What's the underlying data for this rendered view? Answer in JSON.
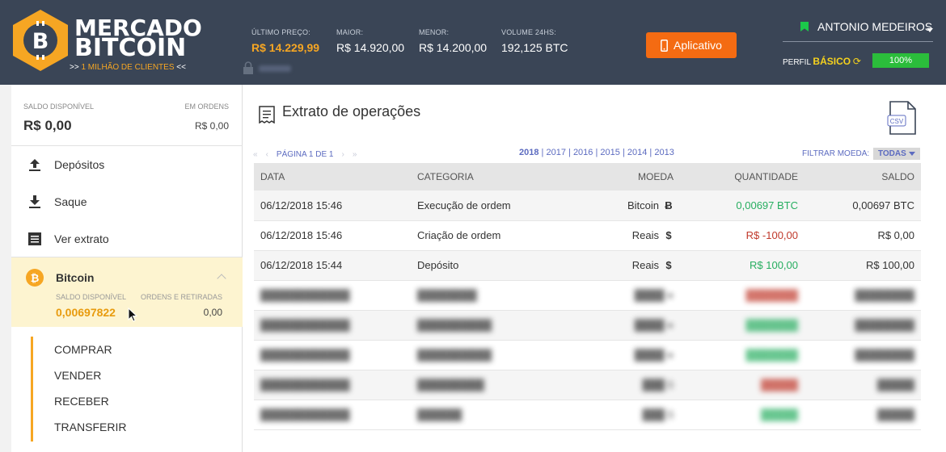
{
  "header": {
    "brand_line1": "MERCADO",
    "brand_line2": "BITCOIN",
    "brand_sub_prefix": ">> ",
    "brand_sub_highlight": "1 MILHÃO DE CLIENTES",
    "brand_sub_suffix": " <<",
    "stats": [
      {
        "label": "ÚLTIMO PREÇO:",
        "value": "R$ 14.229,99"
      },
      {
        "label": "MAIOR:",
        "value": "R$ 14.920,00"
      },
      {
        "label": "MENOR:",
        "value": "R$ 14.200,00"
      },
      {
        "label": "VOLUME 24hs:",
        "value": "192,125 BTC"
      }
    ],
    "app_button": "Aplicativo",
    "user_name": "ANTONIO MEDEIROS",
    "perfil_label": "PERFIL",
    "perfil_value": "BÁSICO",
    "profile_progress": "100%",
    "colors": {
      "header_bg": "#3a4556",
      "accent_orange": "#f46b12",
      "progress_green": "#2bbd3b"
    }
  },
  "sidebar": {
    "saldo_label": "SALDO DISPONÍVEL",
    "saldo_value": "R$ 0,00",
    "ordens_label": "EM ORDENS",
    "ordens_value": "R$ 0,00",
    "menu": [
      {
        "label": "Depósitos",
        "icon": "upload-icon"
      },
      {
        "label": "Saque",
        "icon": "download-icon"
      },
      {
        "label": "Ver extrato",
        "icon": "statement-icon"
      }
    ],
    "bitcoin": {
      "name": "Bitcoin",
      "saldo_label": "SALDO DISPONÍVEL",
      "saldo_value": "0,00697822",
      "ordens_label": "ORDENS E RETIRADAS",
      "ordens_value": "0,00"
    },
    "sub_menu": [
      "COMPRAR",
      "VENDER",
      "RECEBER",
      "TRANSFERIR"
    ]
  },
  "main": {
    "title": "Extrato de operações",
    "csv_label": "CSV",
    "page_label": "PÁGINA 1 DE 1",
    "years": [
      "2018",
      "2017",
      "2016",
      "2015",
      "2014",
      "2013"
    ],
    "filter_label": "FILTRAR MOEDA:",
    "filter_value": "TODAS",
    "columns": [
      "DATA",
      "CATEGORIA",
      "MOEDA",
      "QUANTIDADE",
      "SALDO"
    ],
    "rows": [
      {
        "data": "06/12/2018 15:46",
        "categoria": "Execução de ordem",
        "moeda": "Bitcoin",
        "moeda_icon": "Ƀ",
        "quantidade": "0,00697 BTC",
        "saldo": "0,00697 BTC",
        "sign": "pos"
      },
      {
        "data": "06/12/2018 15:46",
        "categoria": "Criação de ordem",
        "moeda": "Reais",
        "moeda_icon": "$",
        "quantidade": "R$ -100,00",
        "saldo": "R$ 0,00",
        "sign": "neg"
      },
      {
        "data": "06/12/2018 15:44",
        "categoria": "Depósito",
        "moeda": "Reais",
        "moeda_icon": "$",
        "quantidade": "R$ 100,00",
        "saldo": "R$ 100,00",
        "sign": "pos"
      }
    ]
  }
}
